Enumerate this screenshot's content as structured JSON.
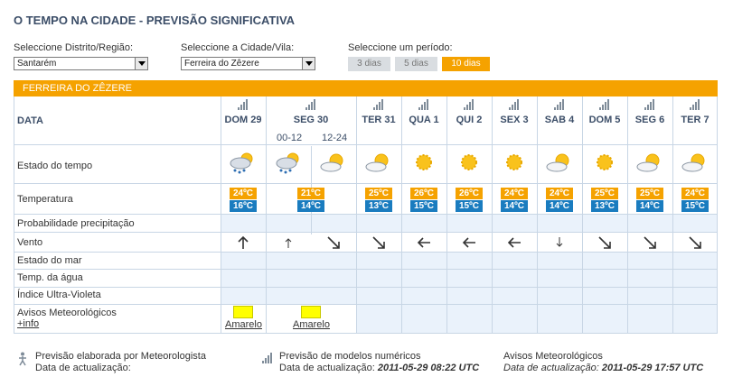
{
  "page_title": "O TEMPO NA CIDADE - PREVISÃO SIGNIFICATIVA",
  "selectors": {
    "district_label": "Seleccione Distrito/Região:",
    "district_value": "Santarém",
    "city_label": "Seleccione a Cidade/Vila:",
    "city_value": "Ferreira do Zêzere",
    "period_label": "Seleccione um período:",
    "periods": [
      "3 dias",
      "5 dias",
      "10 dias"
    ],
    "active_period": "10 dias"
  },
  "location_header": "FERREIRA DO ZÊZERE",
  "table": {
    "data_label": "DATA",
    "row_labels": {
      "weather": "Estado do tempo",
      "temperature": "Temperatura",
      "precip": "Probabilidade precipitação",
      "wind": "Vento",
      "sea": "Estado do mar",
      "water_temp": "Temp. da água",
      "uv": "Índice Ultra-Violeta",
      "warnings": "Avisos Meteorológicos",
      "warnings_link": "+info"
    },
    "days": [
      {
        "label": "DOM 29",
        "icon": "cloud-rain-sun-icon",
        "max": "24ºC",
        "min": "16ºC",
        "wind": "arrow-up-icon",
        "warning": "Amarelo"
      },
      {
        "label": "SEG 30",
        "sub": [
          "00-12",
          "12-24"
        ],
        "icons": [
          "cloud-rain-sun-icon",
          "cloud-sun-icon"
        ],
        "max": "21ºC",
        "min": "14ºC",
        "winds": [
          "arrow-up-small-icon",
          "arrow-down-right-icon"
        ],
        "warning": "Amarelo"
      },
      {
        "label": "TER 31",
        "icon": "cloud-sun-icon",
        "max": "25ºC",
        "min": "13ºC",
        "wind": "arrow-down-right-icon"
      },
      {
        "label": "QUA 1",
        "icon": "sun-icon",
        "max": "26ºC",
        "min": "15ºC",
        "wind": "arrow-left-icon"
      },
      {
        "label": "QUI 2",
        "icon": "sun-icon",
        "max": "26ºC",
        "min": "15ºC",
        "wind": "arrow-left-icon"
      },
      {
        "label": "SEX 3",
        "icon": "sun-icon",
        "max": "24ºC",
        "min": "14ºC",
        "wind": "arrow-left-icon"
      },
      {
        "label": "SAB 4",
        "icon": "cloud-sun-icon",
        "max": "24ºC",
        "min": "14ºC",
        "wind": "arrow-down-small-icon"
      },
      {
        "label": "DOM 5",
        "icon": "sun-icon",
        "max": "25ºC",
        "min": "13ºC",
        "wind": "arrow-down-right-icon"
      },
      {
        "label": "SEG 6",
        "icon": "cloud-sun-icon",
        "max": "25ºC",
        "min": "14ºC",
        "wind": "arrow-down-right-icon"
      },
      {
        "label": "TER 7",
        "icon": "cloud-sun-icon",
        "max": "24ºC",
        "min": "15ºC",
        "wind": "arrow-down-right-icon"
      }
    ]
  },
  "footer": {
    "meteorologist_line1": "Previsão elaborada por Meteorologista",
    "meteorologist_line2": "Data de actualização:",
    "models_line1": "Previsão de modelos numéricos",
    "models_line2_prefix": "Data de actualização:",
    "models_date": "2011-05-29 08:22 UTC",
    "warnings_line1": "Avisos Meteorológicos",
    "warnings_line2_prefix": "Data de actualização:",
    "warnings_date": "2011-05-29 17:57 UTC"
  },
  "colors": {
    "accent": "#f5a200",
    "min_temp": "#1a7cbf",
    "grid": "#c8d6e5",
    "cell_blue": "#eaf2fb",
    "title": "#3c4e68"
  }
}
